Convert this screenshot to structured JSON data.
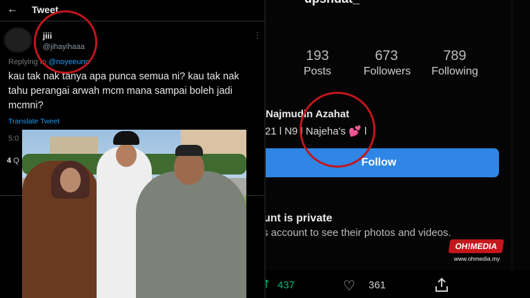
{
  "tweet": {
    "header_title": "Tweet",
    "back_icon": "arrow-left-icon",
    "author_name": "jiii",
    "author_handle": "@jihayihaaa",
    "replying_prefix": "Replying to",
    "replying_to": "@noyeeunn",
    "text": "kau tak nak tanya apa punca semua ni? kau tak nak tahu perangai arwah mcm mana sampai boleh jadi mcmni?",
    "translate_label": "Translate Tweet",
    "time_stub": "5:0",
    "count_stub": "4",
    "count_stub_label": "Q"
  },
  "instagram": {
    "username_partial": "upshdat_",
    "stats": [
      {
        "value": "193",
        "label": "Posts"
      },
      {
        "value": "673",
        "label": "Followers"
      },
      {
        "value": "789",
        "label": "Following"
      }
    ],
    "bio_name": "Najmudin Azahat",
    "bio_line": "'21 l N9 l Najeha's",
    "bio_heart": "💕",
    "bio_tail": " l",
    "follow_label": "Follow",
    "private_title": "unt is private",
    "private_sub": "s account to see their photos and videos.",
    "retweet_count": "437",
    "like_count": "361"
  },
  "watermark": {
    "badge": "OH!MEDIA",
    "url": "www.ohmedia.my"
  },
  "colors": {
    "highlight_circle": "#c2161c",
    "follow_button": "#2f86e6",
    "twitter_link": "#1d9bf0"
  }
}
